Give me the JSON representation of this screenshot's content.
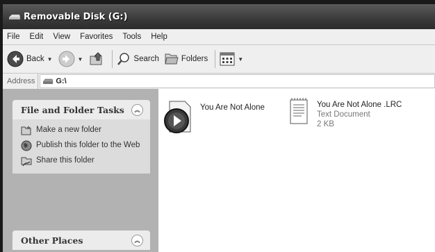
{
  "window": {
    "title": "Removable Disk (G:)"
  },
  "menu": [
    "File",
    "Edit",
    "View",
    "Favorites",
    "Tools",
    "Help"
  ],
  "toolbar": {
    "back_label": "Back",
    "search_label": "Search",
    "folders_label": "Folders"
  },
  "address": {
    "label": "Address",
    "value": "G:\\"
  },
  "task_panes": {
    "file_folder": {
      "title": "File and Folder Tasks",
      "tasks": [
        "Make a new folder",
        "Publish this folder to the Web",
        "Share this folder"
      ]
    },
    "other_places": {
      "title": "Other Places"
    }
  },
  "files": [
    {
      "name": "You Are Not Alone",
      "icon": "media-audio-icon"
    },
    {
      "name": "You Are Not Alone .LRC",
      "type": "Text Document",
      "size": "2 KB",
      "icon": "text-document-icon"
    }
  ]
}
